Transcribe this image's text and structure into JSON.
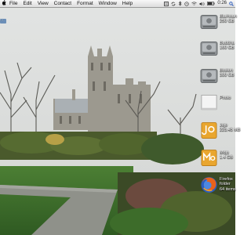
{
  "menubar": {
    "apple_icon": "apple-logo-icon",
    "items": [
      {
        "label": "File"
      },
      {
        "label": "Edit"
      },
      {
        "label": "View"
      },
      {
        "label": "Contact"
      },
      {
        "label": "Format"
      },
      {
        "label": "Window"
      },
      {
        "label": "Help"
      }
    ],
    "extras": {
      "clock": "0:26"
    }
  },
  "desktop": {
    "left_item": {
      "label": "..."
    },
    "items": [
      {
        "icon": "hard-drive-icon",
        "title": "Blurhoun",
        "subtitle": "250 GB"
      },
      {
        "icon": "hard-drive-icon",
        "title": "Buddha",
        "subtitle": "160 GB"
      },
      {
        "icon": "hard-drive-icon",
        "title": "Boston",
        "subtitle": "300 GB"
      },
      {
        "icon": "document-icon",
        "title": "Photo",
        "subtitle": ""
      },
      {
        "icon": "mojo-app-icon",
        "title": "Jojo",
        "subtitle": "223.45 MB"
      },
      {
        "icon": "mojo-app-icon",
        "title": "Mojo",
        "subtitle": "1.4 GB"
      },
      {
        "icon": "firefox-icon",
        "title": "Firefox",
        "subtitle": "folder\n64 items"
      }
    ]
  },
  "colors": {
    "menubar_top": "#f7f7f7",
    "menubar_bottom": "#dcdcdc",
    "sky": "#dadcdb",
    "lawn": "#3e6f2c",
    "path": "#8f918a"
  }
}
